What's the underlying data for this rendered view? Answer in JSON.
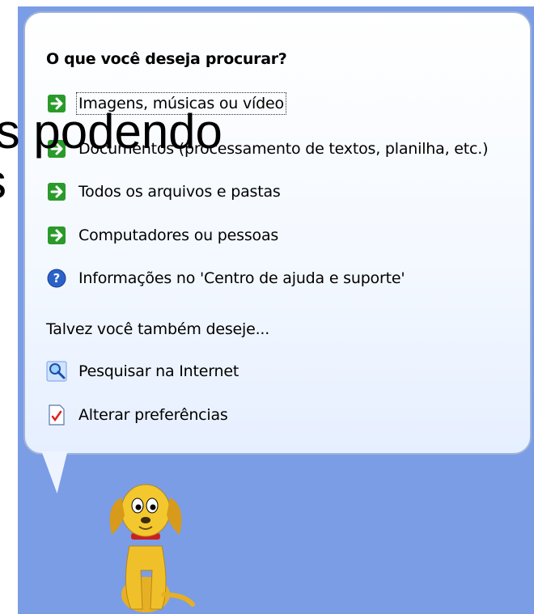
{
  "search_companion": {
    "heading": "O que você deseja procurar?",
    "options": [
      {
        "label": "Imagens, músicas ou vídeo",
        "icon": "green-arrow-icon"
      },
      {
        "label": "Documentos (processamento de textos, planilha, etc.)",
        "icon": "green-arrow-icon"
      },
      {
        "label": "Todos os arquivos e pastas",
        "icon": "green-arrow-icon"
      },
      {
        "label": "Computadores ou pessoas",
        "icon": "green-arrow-icon"
      },
      {
        "label": "Informações no 'Centro de ajuda e suporte'",
        "icon": "help-icon"
      }
    ],
    "subheading": "Talvez você também deseje...",
    "extras": [
      {
        "label": "Pesquisar na Internet",
        "icon": "internet-search-icon"
      },
      {
        "label": "Alterar preferências",
        "icon": "preferences-icon"
      }
    ]
  },
  "slide_overlay": {
    "line1": "/s podendo",
    "line2": "s"
  },
  "colors": {
    "panel_bg": "#7a9de6",
    "arrow_green": "#2a9a2a",
    "help_blue": "#2a62c9"
  }
}
